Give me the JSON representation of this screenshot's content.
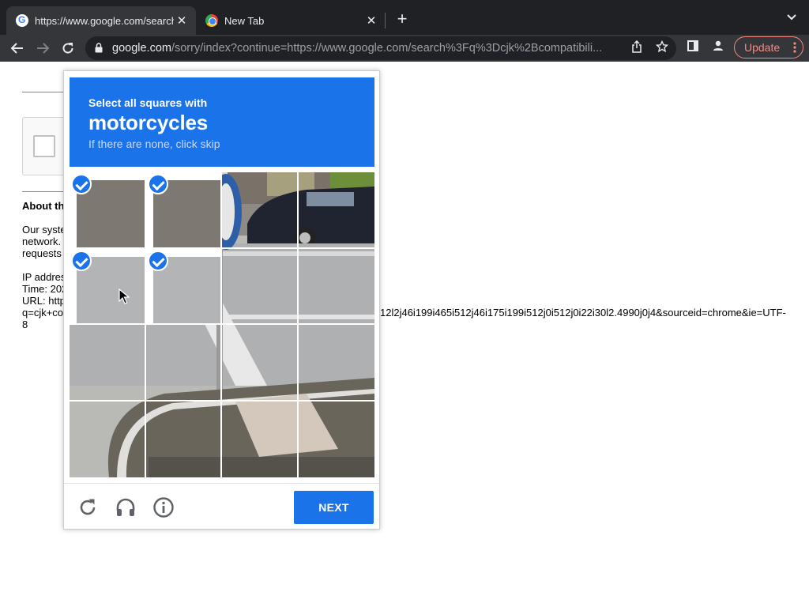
{
  "browser": {
    "tabs": [
      {
        "title": "https://www.google.com/search",
        "favicon": "google-icon",
        "active": true
      },
      {
        "title": "New Tab",
        "favicon": "chrome-icon",
        "active": false
      }
    ],
    "address": {
      "host": "google.com",
      "path": "/sorry/index?continue=https://www.google.com/search%3Fq%3Dcjk%2Bcompatibili..."
    },
    "update_label": "Update"
  },
  "page": {
    "about_heading": "About th",
    "paragraph_lines": [
      "Our syste",
      "network.",
      "requests"
    ],
    "info_lines": [
      "IP addres",
      "Time: 202",
      "URL: http",
      "q=cjk+co",
      "8"
    ],
    "url_tail": "12l2j46i199i465i512j46i175i199i512j0i512j0i22i30l2.4990j0j4&sourceid=chrome&ie=UTF-"
  },
  "captcha": {
    "instruction_line1": "Select all squares with",
    "target": "motorcycles",
    "instruction_line3": "If there are none, click skip",
    "selected_tiles": [
      0,
      1,
      4,
      5
    ],
    "next_label": "NEXT",
    "accent_color": "#1a73e8"
  }
}
